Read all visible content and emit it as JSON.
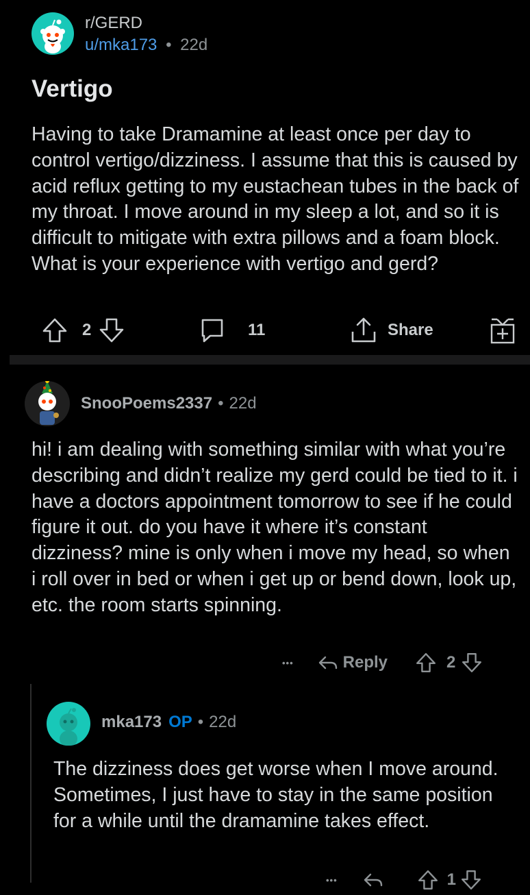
{
  "post": {
    "subreddit": "r/GERD",
    "author": "u/mka173",
    "separator": "•",
    "age": "22d",
    "title": "Vertigo",
    "body": "Having to take Dramamine at least once per day to control vertigo/dizziness. I assume that this is caused by acid reflux getting to my eustachean tubes in the back of my throat. I move around in my sleep a lot, and so it is difficult to mitigate with extra pillows and a foam block. What is your experience with vertigo and gerd?",
    "votes": "2",
    "comments": "11",
    "share_label": "Share",
    "icons": [
      "upvote-icon",
      "downvote-icon",
      "comment-icon",
      "share-icon",
      "award-icon"
    ]
  },
  "comments": [
    {
      "author": "SnooPoems2337",
      "separator": "•",
      "age": "22d",
      "body": "hi! i am dealing with something similar with what you’re describing and didn’t realize my gerd could be tied to it. i have a doctors appointment tomorrow to see if he could figure it out. do you have it where it’s constant dizziness? mine is only when i move my head, so when i roll over in bed or when i get up or bend down, look up, etc. the room starts spinning.",
      "more": "•••",
      "reply_label": "Reply",
      "votes": "2"
    },
    {
      "author": "mka173",
      "op_badge": "OP",
      "separator": "•",
      "age": "22d",
      "body": "The dizziness does get worse when I move around. Sometimes, I just have to stay in the same position for a while until the dramamine takes effect.",
      "more": "•••",
      "votes": "1"
    }
  ],
  "colors": {
    "background": "#000000",
    "subreddit_icon": "#18c8b8",
    "username_link": "#4f9de8",
    "op_badge": "#0079d3"
  }
}
